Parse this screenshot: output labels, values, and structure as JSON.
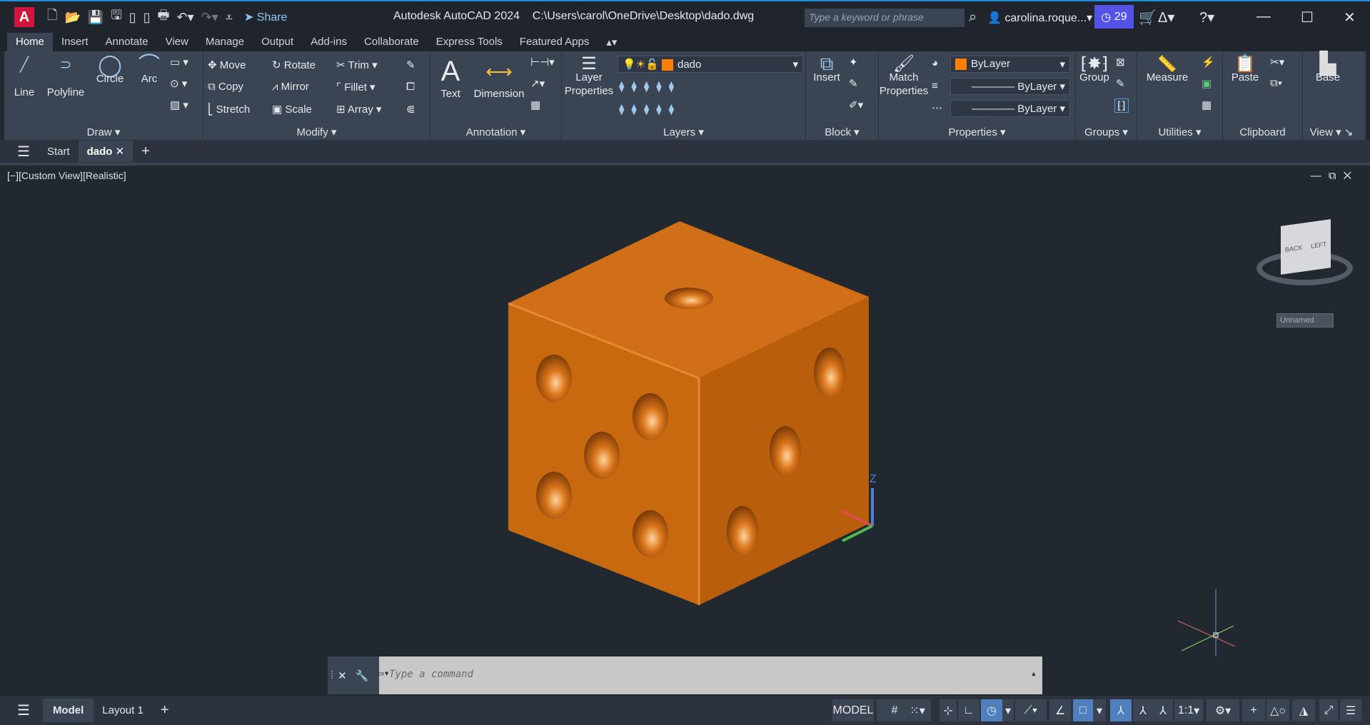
{
  "titlebar": {
    "app_title": "Autodesk AutoCAD 2024",
    "file_path": "C:\\Users\\carol\\OneDrive\\Desktop\\dado.dwg",
    "share": "Share",
    "search_placeholder": "Type a keyword or phrase",
    "user": "carolina.roque...",
    "trial_days": "29"
  },
  "tabs": [
    "Home",
    "Insert",
    "Annotate",
    "View",
    "Manage",
    "Output",
    "Add-ins",
    "Collaborate",
    "Express Tools",
    "Featured Apps"
  ],
  "ribbon": {
    "draw": {
      "title": "Draw",
      "line": "Line",
      "polyline": "Polyline",
      "circle": "Circle",
      "arc": "Arc"
    },
    "modify": {
      "title": "Modify",
      "move": "Move",
      "rotate": "Rotate",
      "trim": "Trim",
      "copy": "Copy",
      "mirror": "Mirror",
      "fillet": "Fillet",
      "stretch": "Stretch",
      "scale": "Scale",
      "array": "Array"
    },
    "annotation": {
      "title": "Annotation",
      "text": "Text",
      "dimension": "Dimension"
    },
    "layers": {
      "title": "Layers",
      "layer_properties": "Layer Properties",
      "current_layer": "dado"
    },
    "block": {
      "title": "Block",
      "insert": "Insert"
    },
    "properties": {
      "title": "Properties",
      "match": "Match Properties",
      "color": "ByLayer",
      "linetype": "ByLayer",
      "lineweight": "ByLayer"
    },
    "groups": {
      "title": "Groups",
      "group": "Group"
    },
    "utilities": {
      "title": "Utilities",
      "measure": "Measure"
    },
    "clipboard": {
      "title": "Clipboard",
      "paste": "Paste"
    },
    "view": {
      "title": "View",
      "base": "Base"
    }
  },
  "file_tabs": {
    "start": "Start",
    "active": "dado"
  },
  "viewport": {
    "label": "[−][Custom View][Realistic]",
    "viewcube_named": "Unnamed",
    "viewcube_faces": [
      "BACK",
      "LEFT"
    ],
    "ucs_axis": "Z",
    "die_color": "#d9741a"
  },
  "command": {
    "placeholder": "Type a command"
  },
  "status": {
    "model_tab": "Model",
    "layout_tab": "Layout 1",
    "model": "MODEL",
    "scale": "1:1"
  },
  "colors": {
    "accent": "#4f80bd",
    "badge": "#5353e8",
    "layer_color": "#ff8000"
  }
}
